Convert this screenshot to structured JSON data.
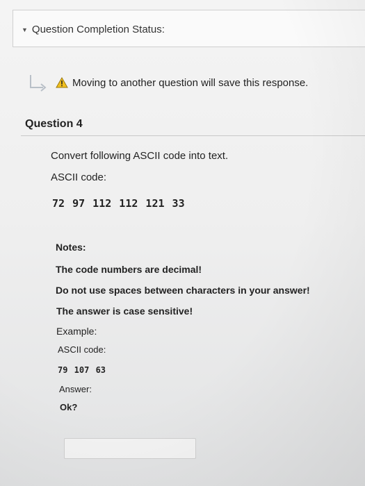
{
  "status": {
    "title": "Question Completion Status:"
  },
  "warning": {
    "text": "Moving to another question will save this response."
  },
  "question": {
    "title": "Question 4",
    "prompt": "Convert following ASCII code into text.",
    "ascii_label": "ASCII code:",
    "ascii_codes": "72 97 112 112 121 33"
  },
  "notes": {
    "heading": "Notes:",
    "line1": "The code numbers are decimal!",
    "line2": "Do not use spaces between characters in your answer!",
    "line3": "The answer is case sensitive!",
    "example_label": "Example:",
    "example_ascii_label": "ASCII code:",
    "example_codes": "79 107 63",
    "answer_label": "Answer:",
    "answer_value": "Ok?"
  },
  "answer_input": {
    "value": ""
  },
  "colors": {
    "warning_yellow": "#f2c01e",
    "return_arrow": "#b9c0c8"
  }
}
